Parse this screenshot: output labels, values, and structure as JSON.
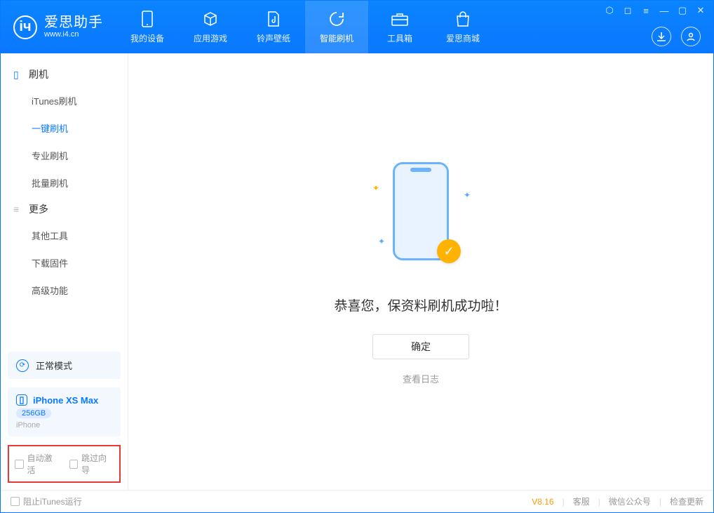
{
  "app": {
    "name_cn": "爱思助手",
    "url": "www.i4.cn"
  },
  "tabs": {
    "device": "我的设备",
    "apps": "应用游戏",
    "ringtone": "铃声壁纸",
    "flash": "智能刷机",
    "toolbox": "工具箱",
    "store": "爱思商城"
  },
  "sidebar": {
    "section_flash": "刷机",
    "items_flash": {
      "a": "iTunes刷机",
      "b": "一键刷机",
      "c": "专业刷机",
      "d": "批量刷机"
    },
    "section_more": "更多",
    "items_more": {
      "a": "其他工具",
      "b": "下载固件",
      "c": "高级功能"
    }
  },
  "mode_label": "正常模式",
  "device": {
    "name": "iPhone XS Max",
    "storage": "256GB",
    "type": "iPhone"
  },
  "options": {
    "auto_activate": "自动激活",
    "skip_guide": "跳过向导"
  },
  "main": {
    "success": "恭喜您，保资料刷机成功啦！",
    "ok": "确定",
    "log": "查看日志"
  },
  "status": {
    "block_itunes": "阻止iTunes运行",
    "version": "V8.16",
    "support": "客服",
    "wechat": "微信公众号",
    "update": "检查更新"
  }
}
